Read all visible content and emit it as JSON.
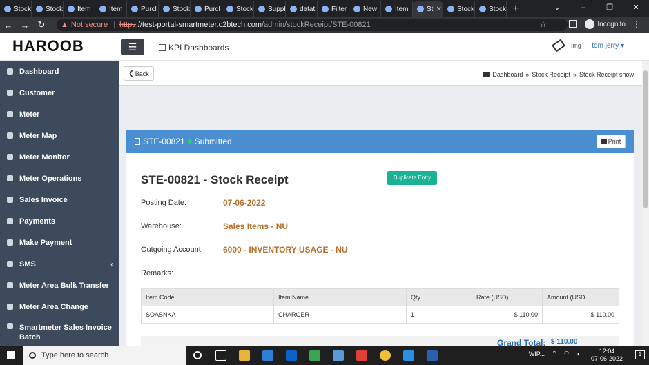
{
  "browser": {
    "tabs": [
      {
        "label": "Stock"
      },
      {
        "label": "Stock"
      },
      {
        "label": "Item"
      },
      {
        "label": "Item"
      },
      {
        "label": "Purcl"
      },
      {
        "label": "Stock"
      },
      {
        "label": "Purcl"
      },
      {
        "label": "Stock"
      },
      {
        "label": "Suppl"
      },
      {
        "label": "datat"
      },
      {
        "label": "Filter"
      },
      {
        "label": "New"
      },
      {
        "label": "Item"
      },
      {
        "label": "St"
      },
      {
        "label": "Stock"
      },
      {
        "label": "Stock"
      }
    ],
    "new_tab": "+",
    "address": {
      "security_label": "Not secure",
      "scheme": "https",
      "host": "://test-portal-smartmeter.c2btech.com",
      "path": "/admin/stockReceipt/STE-00821"
    },
    "profile": "Incognito"
  },
  "header": {
    "logo": "HAROOB",
    "kpi_label": "KPI Dashboards",
    "avatar_alt": "img",
    "user": "tom jerry"
  },
  "sidebar": {
    "items": [
      {
        "label": "Dashboard"
      },
      {
        "label": "Customer"
      },
      {
        "label": "Meter"
      },
      {
        "label": "Meter Map"
      },
      {
        "label": "Meter Monitor"
      },
      {
        "label": "Meter Operations"
      },
      {
        "label": "Sales Invoice"
      },
      {
        "label": "Payments"
      },
      {
        "label": "Make Payment"
      },
      {
        "label": "SMS"
      },
      {
        "label": "Meter Area Bulk Transfer"
      },
      {
        "label": "Meter Area Change"
      },
      {
        "label": "Smartmeter Sales Invoice Batch"
      }
    ]
  },
  "breadcrumb": {
    "back": "Back",
    "items": [
      "Dashboard",
      "Stock Receipt",
      "Stock Receipt show"
    ]
  },
  "panel": {
    "doc_id": "STE-00821",
    "status": "Submitted",
    "print": "Print",
    "title": "STE-00821 - Stock Receipt",
    "duplicate": "Duplicate Entry",
    "fields": [
      {
        "label": "Posting Date:",
        "value": "07-06-2022"
      },
      {
        "label": "Warehouse:",
        "value": "Sales Items - NU"
      },
      {
        "label": "Outgoing Account:",
        "value": "6000 - INVENTORY USAGE - NU"
      },
      {
        "label": "Remarks:",
        "value": ""
      }
    ],
    "table": {
      "headers": [
        "Item Code",
        "Item Name",
        "Qty",
        "Rate (USD)",
        "Amount (USD"
      ],
      "rows": [
        [
          "SOASNKA",
          "CHARGER",
          "1",
          "$ 110.00",
          "$ 110.00"
        ]
      ]
    },
    "grand_total_label": "Grand Total:",
    "grand_total_value": "$ 110.00"
  },
  "taskbar": {
    "search_placeholder": "Type here to search",
    "tray_text": "WIP...",
    "time": "12:04",
    "date": "07-06-2022",
    "notifications": "1"
  }
}
